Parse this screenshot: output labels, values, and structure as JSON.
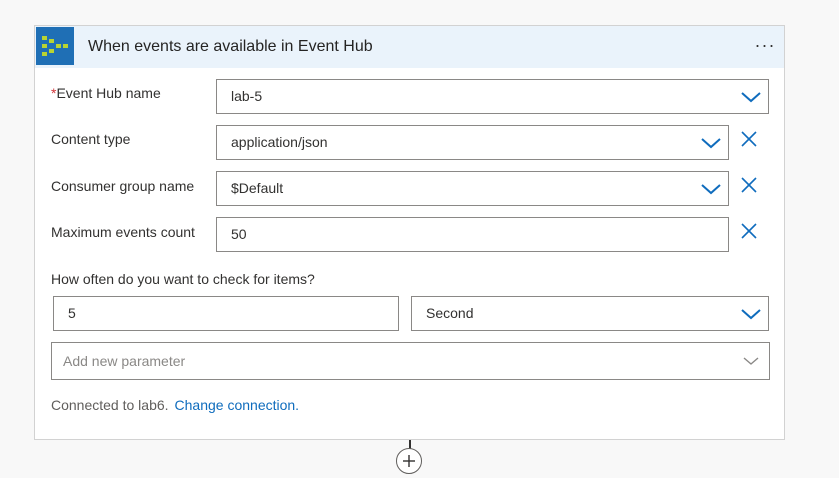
{
  "trigger": {
    "title": "When events are available in Event Hub",
    "more_icon": "ellipsis-icon",
    "icon": "event-hub-icon",
    "accent_color": "#1f6fb5"
  },
  "fields": {
    "event_hub_name": {
      "required_marker": "*",
      "label": "Event Hub name",
      "value": "lab-5"
    },
    "content_type": {
      "label": "Content type",
      "value": "application/json"
    },
    "consumer_group": {
      "label": "Consumer group name",
      "value": "$Default"
    },
    "max_events": {
      "label": "Maximum events count",
      "value": "50"
    }
  },
  "recurrence": {
    "label": "How often do you want to check for items?",
    "interval": "5",
    "frequency": "Second"
  },
  "add_parameter": {
    "placeholder": "Add new parameter"
  },
  "connection": {
    "text": "Connected to lab6.",
    "change_link": "Change connection."
  }
}
